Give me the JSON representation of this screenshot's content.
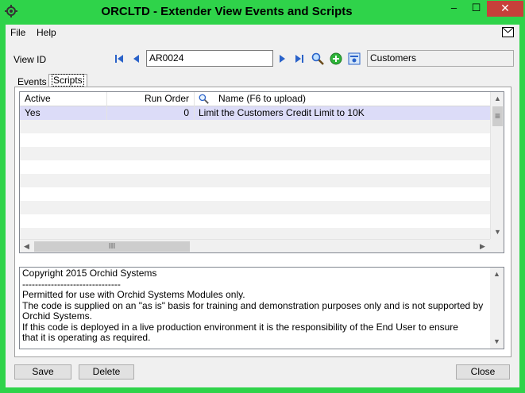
{
  "window": {
    "title": "ORCLTD - Extender View Events and Scripts",
    "min_glyph": "–",
    "max_glyph": "☐",
    "close_glyph": "✕"
  },
  "menu": {
    "file": "File",
    "help": "Help"
  },
  "view": {
    "label": "View ID",
    "value": "AR0024",
    "description": "Customers"
  },
  "tabs": {
    "events": "Events",
    "scripts": "Scripts"
  },
  "grid": {
    "columns": [
      "Active",
      "Run Order",
      "Name (F6 to upload)"
    ],
    "rows": [
      {
        "active": "Yes",
        "run_order": "0",
        "name": "Limit the Customers Credit Limit to 10K"
      }
    ],
    "hscroll_grip": "III",
    "vscroll_grip": "≡"
  },
  "notes": {
    "text": "Copyright 2015 Orchid Systems\n-------------------------------\nPermitted for use with Orchid Systems Modules only.\nThe code is supplied on an \"as is\" basis for training and demonstration purposes only and is not supported by Orchid Systems.\nIf this code is deployed in a live production environment it is the responsibility of the End User to ensure\nthat it is operating as required."
  },
  "buttons": {
    "save": "Save",
    "delete": "Delete",
    "close": "Close"
  },
  "colors": {
    "titlebar": "#2fd34a",
    "close": "#c7403a",
    "selected_row": "#dcdcf8",
    "nav_arrow": "#2a62c9"
  }
}
